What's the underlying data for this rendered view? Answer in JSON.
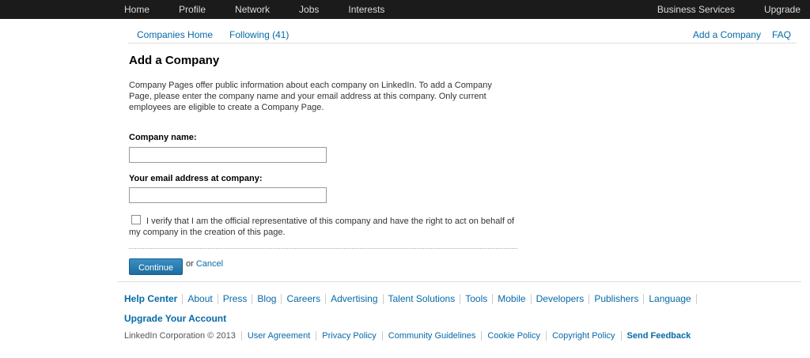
{
  "topnav": {
    "left": [
      "Home",
      "Profile",
      "Network",
      "Jobs",
      "Interests"
    ],
    "right": [
      "Business Services",
      "Upgrade"
    ]
  },
  "subnav": {
    "left": [
      "Companies Home",
      "Following (41)"
    ],
    "right": [
      "Add a Company",
      "FAQ"
    ]
  },
  "page": {
    "title": "Add a Company",
    "intro": "Company Pages offer public information about each company on LinkedIn. To add a Company Page, please enter the company name and your email address at this company. Only current employees are eligible to create a Company Page."
  },
  "form": {
    "company_name_label": "Company name:",
    "company_name_value": "",
    "email_label": "Your email address at company:",
    "email_value": "",
    "verify_text": "I verify that I am the official representative of this company and have the right to act on behalf of my company in the creation of this page.",
    "verify_checked": false,
    "continue_label": "Continue",
    "or_text": "or",
    "cancel_label": "Cancel"
  },
  "footer": {
    "links": [
      "Help Center",
      "About",
      "Press",
      "Blog",
      "Careers",
      "Advertising",
      "Talent Solutions",
      "Tools",
      "Mobile",
      "Developers",
      "Publishers",
      "Language"
    ],
    "upgrade_account": "Upgrade Your Account",
    "copyright": "LinkedIn Corporation © 2013",
    "legal_links": [
      "User Agreement",
      "Privacy Policy",
      "Community Guidelines",
      "Cookie Policy",
      "Copyright Policy"
    ],
    "send_feedback": "Send Feedback"
  },
  "colors": {
    "topbar": "#1b1b1b",
    "link": "#0669a8",
    "button": "#1e6d9e"
  }
}
